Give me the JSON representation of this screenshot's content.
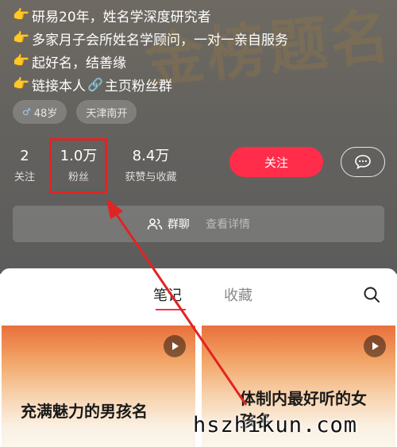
{
  "bio": {
    "lines": [
      "研易20年，姓名学深度研究者",
      "多家月子会所姓名学顾问，一对一亲自服务",
      "起好名，结善缘",
      "链接本人"
    ],
    "link_text": "主页粉丝群"
  },
  "tags": {
    "age": "48岁",
    "location": "天津南开"
  },
  "stats": {
    "following": {
      "value": "2",
      "label": "关注"
    },
    "fans": {
      "value": "1.0万",
      "label": "粉丝"
    },
    "likes": {
      "value": "8.4万",
      "label": "获赞与收藏"
    }
  },
  "actions": {
    "follow_label": "关注"
  },
  "group_bar": {
    "label": "群聊",
    "detail": "查看详情"
  },
  "tabs": [
    "笔记",
    "收藏"
  ],
  "notes": [
    {
      "title": "充满魅力的男孩名"
    },
    {
      "title": "体制内最好听的女孩名"
    }
  ],
  "watermark": "hszhikun.com",
  "colors": {
    "accent": "#ff2d4a",
    "annotation": "#e02424",
    "header_bg": "#64625e"
  },
  "icons": [
    "pointing-hand-icon",
    "link-icon",
    "gender-icon",
    "chat-bubble-icon",
    "group-icon",
    "search-icon",
    "play-icon"
  ]
}
